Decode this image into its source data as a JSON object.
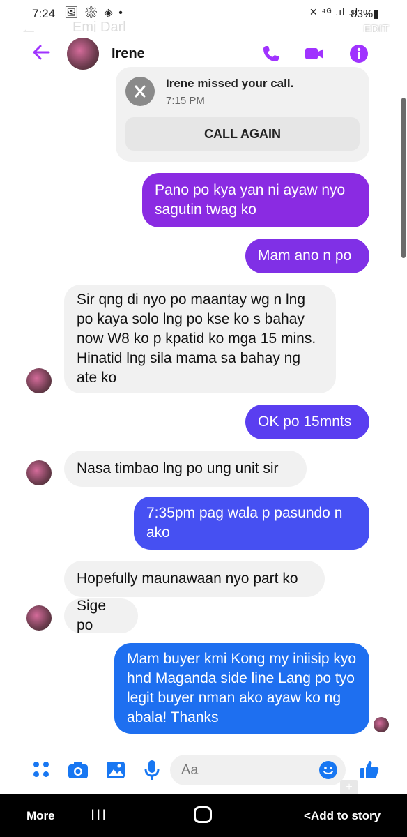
{
  "status_bar": {
    "time": "7:24",
    "left_icons": "🖼 ⚙ ◈ •",
    "right_icons": "✕ ⁴ᴳ .ıl .ıl",
    "battery": "83%▮"
  },
  "overlay": {
    "back_glyph": "←",
    "name": "Emj Darl",
    "edit_label": "EDIT"
  },
  "header": {
    "contact_name": "Irene",
    "accent_color": "#a033ff"
  },
  "call_card": {
    "text": "Irene missed your call.",
    "time": "7:15 PM",
    "button_label": "CALL AGAIN"
  },
  "messages": [
    {
      "direction": "out",
      "text": "Pano po kya yan ni ayaw  nyo sagutin twag ko",
      "color": "#8a2be2"
    },
    {
      "direction": "out",
      "text": "Mam ano n po",
      "color": "#8030e6"
    },
    {
      "direction": "in",
      "text": "Sir qng di nyo po maantay wg n lng po kaya solo lng po kse ko s bahay now W8 ko p kpatid ko mga 15 mins. Hinatid lng sila mama sa bahay ng ate ko"
    },
    {
      "direction": "out",
      "text": "OK po 15mnts",
      "color": "#5a3ef0"
    },
    {
      "direction": "in",
      "text": "Nasa timbao lng po ung unit sir"
    },
    {
      "direction": "out",
      "text": "7:35pm pag wala p pasundo n ako",
      "color": "#4650f2"
    },
    {
      "direction": "in",
      "text": "Hopefully maunawaan nyo part ko"
    },
    {
      "direction": "in",
      "text": "Sige po"
    },
    {
      "direction": "out",
      "text": "Mam buyer kmi Kong my iniisip kyo hnd Maganda side  line Lang po tyo legit buyer nman  ako ayaw ko ng abala! Thanks",
      "color": "#1e6ff0"
    }
  ],
  "composer": {
    "placeholder": "Aa"
  },
  "navbar": {
    "more_label": "More",
    "recent_glyph": "III",
    "add_to_story_label": "Add to story",
    "back_glyph": "<"
  }
}
